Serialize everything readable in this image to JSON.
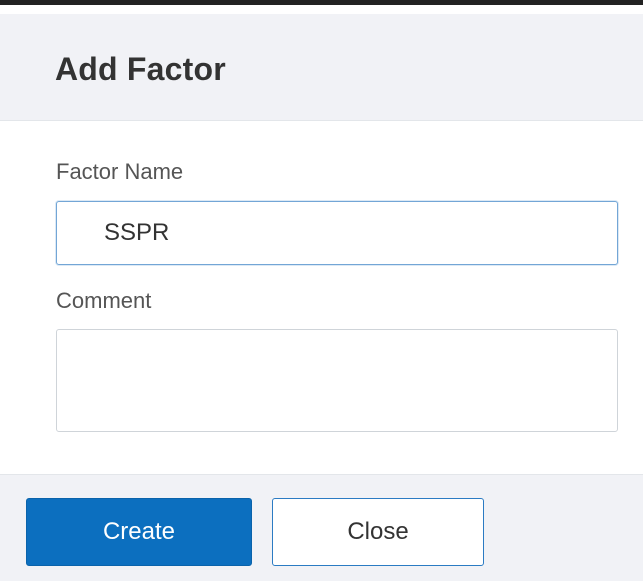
{
  "dialog": {
    "title": "Add Factor"
  },
  "form": {
    "factor_name_label": "Factor Name",
    "factor_name_value": "SSPR",
    "comment_label": "Comment",
    "comment_value": ""
  },
  "footer": {
    "create_label": "Create",
    "close_label": "Close"
  },
  "colors": {
    "primary_button": "#0c6fbf",
    "header_background": "#f1f2f6",
    "focus_border": "#73a6d6"
  }
}
